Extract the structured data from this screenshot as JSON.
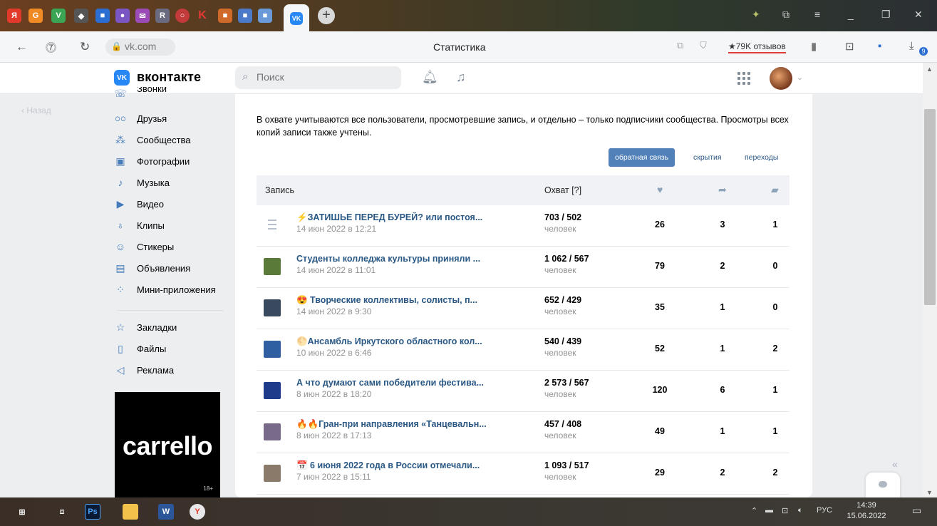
{
  "browser": {
    "url": "vk.com",
    "page_title": "Статистика",
    "reviews_badge": "★79K отзывов",
    "download_count": "9"
  },
  "vk_header": {
    "logo_text": "вконтакте",
    "logo_mark": "VK",
    "search_placeholder": "Поиск"
  },
  "back_link": "Назад",
  "sidebar": {
    "partial_top": "Звонки",
    "items": [
      {
        "label": "Друзья",
        "icon": "friends-icon"
      },
      {
        "label": "Сообщества",
        "icon": "communities-icon"
      },
      {
        "label": "Фотографии",
        "icon": "photos-icon"
      },
      {
        "label": "Музыка",
        "icon": "music-icon"
      },
      {
        "label": "Видео",
        "icon": "video-icon"
      },
      {
        "label": "Клипы",
        "icon": "clips-icon"
      },
      {
        "label": "Стикеры",
        "icon": "stickers-icon"
      },
      {
        "label": "Объявления",
        "icon": "classifieds-icon"
      },
      {
        "label": "Мини-приложения",
        "icon": "mini-apps-icon"
      }
    ],
    "secondary": [
      {
        "label": "Закладки",
        "icon": "bookmarks-icon"
      },
      {
        "label": "Файлы",
        "icon": "files-icon"
      },
      {
        "label": "Реклама",
        "icon": "ads-icon"
      }
    ]
  },
  "ad": {
    "logo": "carrello",
    "age": "18+"
  },
  "main": {
    "description": "В охвате учитываются все пользователи, просмотревшие запись, и отдельно – только подписчики сообщества. Просмотры всех копий записи также учтены.",
    "filters": [
      {
        "label": "обратная связь",
        "active": true
      },
      {
        "label": "скрытия",
        "active": false
      },
      {
        "label": "переходы",
        "active": false
      }
    ],
    "columns": {
      "post": "Запись",
      "reach": "Охват [?]"
    },
    "rows": [
      {
        "title": "⚡ЗАТИШЬЕ ПЕРЕД БУРЕЙ? или постоя...",
        "date": "14 июн 2022 в 12:21",
        "reach": "703 / 502",
        "unit": "человек",
        "likes": "26",
        "shares": "3",
        "comments": "1",
        "thumb": "text"
      },
      {
        "title": "Студенты колледжа культуры приняли ...",
        "date": "14 июн 2022 в 11:01",
        "reach": "1 062 / 567",
        "unit": "человек",
        "likes": "79",
        "shares": "2",
        "comments": "0",
        "thumb": "#5a7a3a"
      },
      {
        "title": "😍 Творческие коллективы, солисты, п...",
        "date": "14 июн 2022 в 9:30",
        "reach": "652 / 429",
        "unit": "человек",
        "likes": "35",
        "shares": "1",
        "comments": "0",
        "thumb": "#3a4a5e"
      },
      {
        "title": "🌕Ансамбль Иркутского областного кол...",
        "date": "10 июн 2022 в 6:46",
        "reach": "540 / 439",
        "unit": "человек",
        "likes": "52",
        "shares": "1",
        "comments": "2",
        "thumb": "#2f5fa0"
      },
      {
        "title": "А что думают сами победители фестива...",
        "date": "8 июн 2022 в 18:20",
        "reach": "2 573 / 567",
        "unit": "человек",
        "likes": "120",
        "shares": "6",
        "comments": "1",
        "thumb": "#1e3a8a"
      },
      {
        "title": "🔥🔥Гран-при направления «Танцевальн...",
        "date": "8 июн 2022 в 17:13",
        "reach": "457 / 408",
        "unit": "человек",
        "likes": "49",
        "shares": "1",
        "comments": "1",
        "thumb": "#7a6a8a"
      },
      {
        "title": "📅 6 июня 2022 года в России отмечали...",
        "date": "7 июн 2022 в 15:11",
        "reach": "1 093 / 517",
        "unit": "человек",
        "likes": "29",
        "shares": "2",
        "comments": "2",
        "thumb": "#8a7a6a"
      }
    ]
  },
  "taskbar": {
    "time": "14:39",
    "date": "15.06.2022",
    "lang": "РУС"
  }
}
